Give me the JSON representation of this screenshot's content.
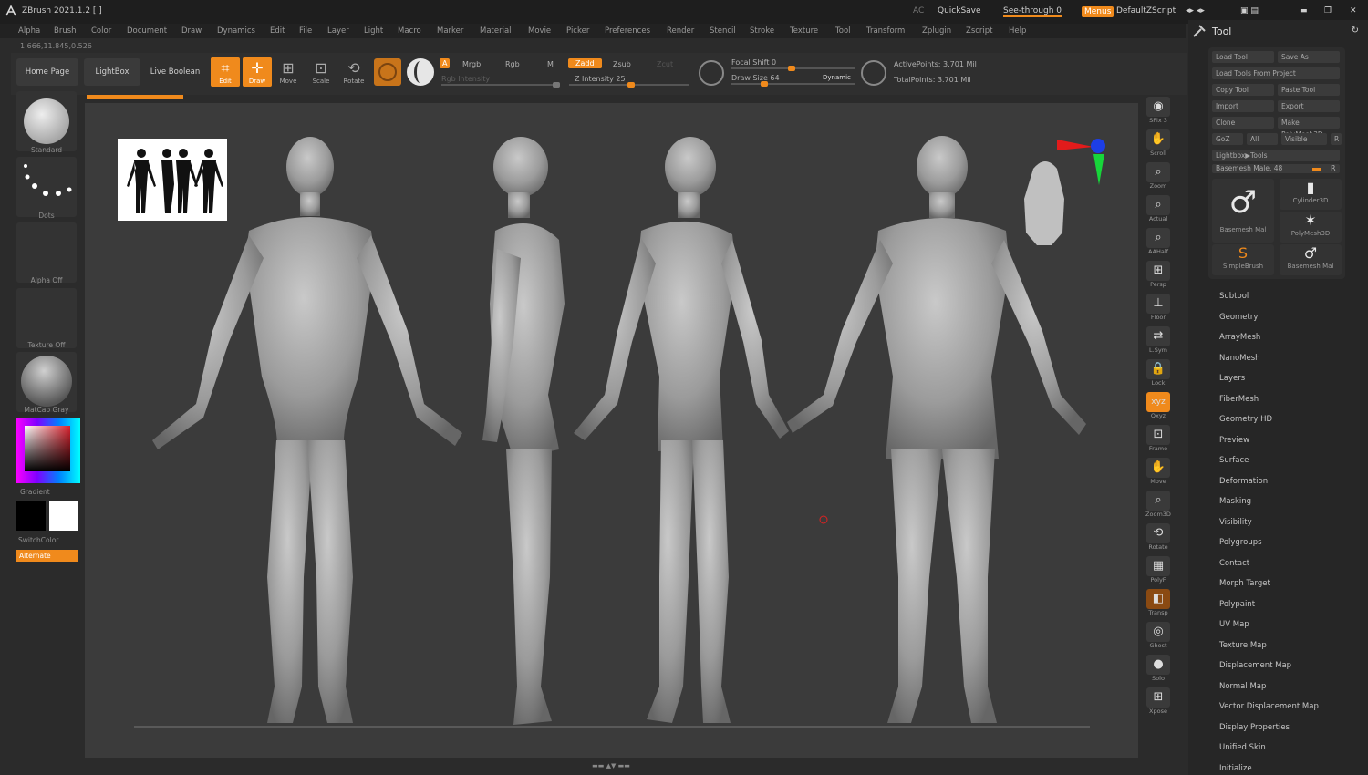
{
  "window": {
    "title": "ZBrush 2021.1.2 [ ]",
    "ac": "AC",
    "quicksave": "QuickSave",
    "see_through": "See-through  0",
    "menus": "Menus",
    "default_script": "DefaultZScript"
  },
  "menubar": [
    "Alpha",
    "Brush",
    "Color",
    "Document",
    "Draw",
    "Dynamics",
    "Edit",
    "File",
    "Layer",
    "Light",
    "Macro",
    "Marker",
    "Material",
    "Movie",
    "Picker",
    "Preferences",
    "Render",
    "Stencil",
    "Stroke",
    "Texture",
    "Tool",
    "Transform",
    "Zplugin",
    "Zscript",
    "Help"
  ],
  "coords": "1.666,11.845,0.526",
  "toolbar": {
    "home_page": "Home Page",
    "lightbox": "LightBox",
    "live_boolean": "Live Boolean",
    "edit": "Edit",
    "draw": "Draw",
    "move": "Move",
    "scale": "Scale",
    "rotate": "Rotate",
    "a": "A",
    "mrgb": "Mrgb",
    "rgb": "Rgb",
    "m": "M",
    "rgb_intensity": "Rgb Intensity",
    "zadd": "Zadd",
    "zsub": "Zsub",
    "zcut": "Zcut",
    "z_intensity": "Z Intensity 25",
    "focal_shift": "Focal Shift 0",
    "draw_size": "Draw Size 64",
    "dynamic": "Dynamic",
    "active_points": "ActivePoints: 3.701 Mil",
    "total_points": "TotalPoints: 3.701 Mil"
  },
  "progress": 1.0,
  "leftshelf": {
    "brush": "Standard",
    "stroke": "Dots",
    "alpha": "Alpha Off",
    "texture": "Texture Off",
    "material": "MatCap Gray",
    "gradient": "Gradient",
    "switch_color": "SwitchColor",
    "alternate": "Alternate",
    "colors": {
      "primary": "#000000",
      "secondary": "#ffffff",
      "accent": "#f08a1c"
    }
  },
  "rightstrip": [
    {
      "label": "SPix 3",
      "icon": "spix-icon"
    },
    {
      "label": "Scroll",
      "icon": "scroll-icon"
    },
    {
      "label": "Zoom",
      "icon": "zoom-icon"
    },
    {
      "label": "Actual",
      "icon": "actual-icon"
    },
    {
      "label": "AAHalf",
      "icon": "aahalf-icon"
    },
    {
      "label": "Persp",
      "icon": "persp-icon"
    },
    {
      "label": "Floor",
      "icon": "floor-icon"
    },
    {
      "label": "L.Sym",
      "icon": "lsym-icon"
    },
    {
      "label": "Lock",
      "icon": "lock-icon"
    },
    {
      "label": "Qxyz",
      "icon": "xyz-icon"
    },
    {
      "label": "Frame",
      "icon": "frame-icon"
    },
    {
      "label": "Move",
      "icon": "move-icon"
    },
    {
      "label": "Zoom3D",
      "icon": "zoom3d-icon"
    },
    {
      "label": "Rotate",
      "icon": "rotate-icon"
    },
    {
      "label": "PolyF",
      "icon": "polyf-icon"
    },
    {
      "label": "Transp",
      "icon": "transp-icon"
    },
    {
      "label": "Ghost",
      "icon": "ghost-icon"
    },
    {
      "label": "Solo",
      "icon": "solo-icon"
    },
    {
      "label": "Xpose",
      "icon": "xpose-icon"
    }
  ],
  "toolpalette": {
    "title": "Tool",
    "buttons": [
      [
        "Load Tool",
        "Save As"
      ],
      [
        "Load Tools From Project",
        ""
      ],
      [
        "Copy Tool",
        "Paste Tool"
      ],
      [
        "Import",
        "Export"
      ],
      [
        "Clone",
        "Make PolyMesh3D"
      ],
      [
        "GoZ",
        "All",
        "Visible",
        "R"
      ],
      [
        "Lightbox▶Tools",
        ""
      ]
    ],
    "current_tool": "Basemesh Male. 48",
    "r": "R",
    "thumbs": [
      {
        "label": "Basemesh Mal",
        "glyph": "♂"
      },
      {
        "label": "Cylinder3D",
        "glyph": "▮"
      },
      {
        "label": "PolyMesh3D",
        "glyph": "✶"
      },
      {
        "label": "SimpleBrush",
        "glyph": "S"
      },
      {
        "label": "Basemesh Mal",
        "glyph": "♂"
      }
    ],
    "menus": [
      "Subtool",
      "Geometry",
      "ArrayMesh",
      "NanoMesh",
      "Layers",
      "FiberMesh",
      "Geometry HD",
      "Preview",
      "Surface",
      "Deformation",
      "Masking",
      "Visibility",
      "Polygroups",
      "Contact",
      "Morph Target",
      "Polypaint",
      "UV Map",
      "Texture Map",
      "Displacement Map",
      "Normal Map",
      "Vector Displacement Map",
      "Display Properties",
      "Unified Skin",
      "Initialize"
    ]
  }
}
